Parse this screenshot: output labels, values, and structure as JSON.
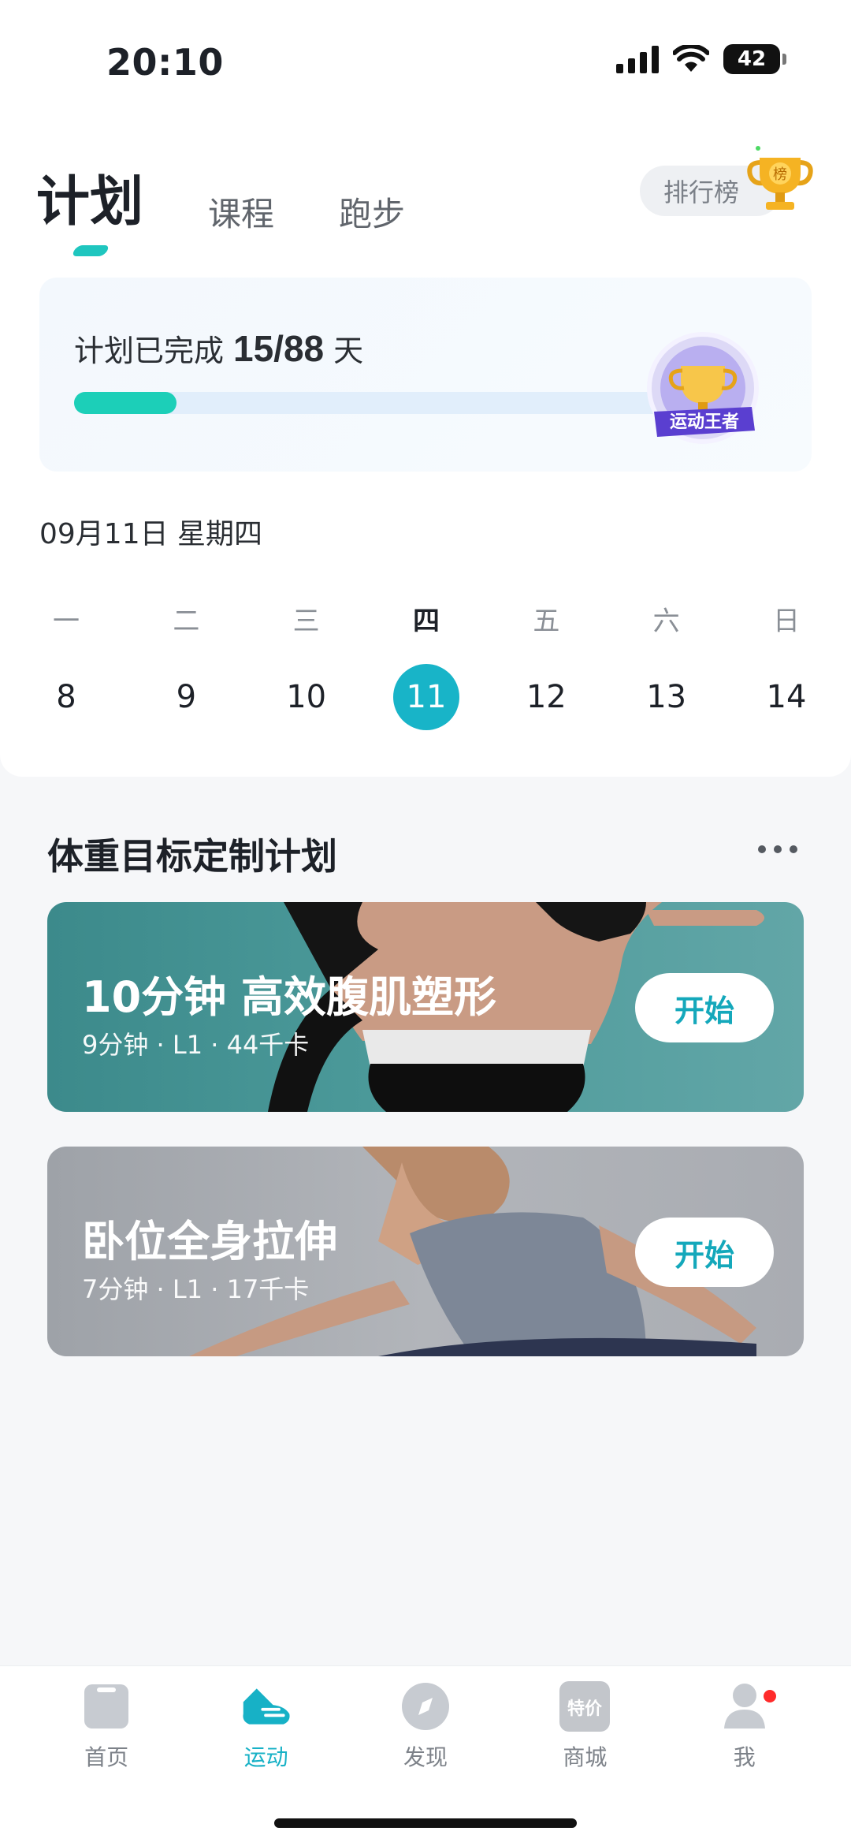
{
  "status_bar": {
    "time": "20:10",
    "battery": "42"
  },
  "tabs": [
    {
      "label": "计划",
      "active": true
    },
    {
      "label": "课程",
      "active": false
    },
    {
      "label": "跑步",
      "active": false
    }
  ],
  "ranking": {
    "label": "排行榜",
    "trophy_text": "榜"
  },
  "progress": {
    "prefix": "计划已完成",
    "value": "15/88",
    "suffix": "天",
    "completed": 15,
    "total": 88,
    "badge_text": "运动王者"
  },
  "date_label": "09月11日 星期四",
  "week": [
    {
      "name": "一",
      "num": "8",
      "today": false
    },
    {
      "name": "二",
      "num": "9",
      "today": false
    },
    {
      "name": "三",
      "num": "10",
      "today": false
    },
    {
      "name": "四",
      "num": "11",
      "today": true
    },
    {
      "name": "五",
      "num": "12",
      "today": false
    },
    {
      "name": "六",
      "num": "13",
      "today": false
    },
    {
      "name": "日",
      "num": "14",
      "today": false
    }
  ],
  "section": {
    "title": "体重目标定制计划"
  },
  "workouts": [
    {
      "title": "10分钟 高效腹肌塑形",
      "meta": "9分钟 · L1 · 44千卡",
      "button": "开始"
    },
    {
      "title": "卧位全身拉伸",
      "meta": "7分钟 · L1 · 17千卡",
      "button": "开始"
    }
  ],
  "bottom_nav": [
    {
      "label": "首页",
      "icon": "home-icon",
      "active": false
    },
    {
      "label": "运动",
      "icon": "sneaker-icon",
      "active": true
    },
    {
      "label": "发现",
      "icon": "compass-icon",
      "active": false
    },
    {
      "label": "商城",
      "icon": "sale-tag-icon",
      "icon_text": "特价",
      "active": false
    },
    {
      "label": "我",
      "icon": "profile-icon",
      "active": false
    }
  ],
  "colors": {
    "accent": "#18b4c8",
    "progress": "#1ccfb8",
    "card1": "#3c8a8b",
    "card2": "#a9acb2"
  }
}
